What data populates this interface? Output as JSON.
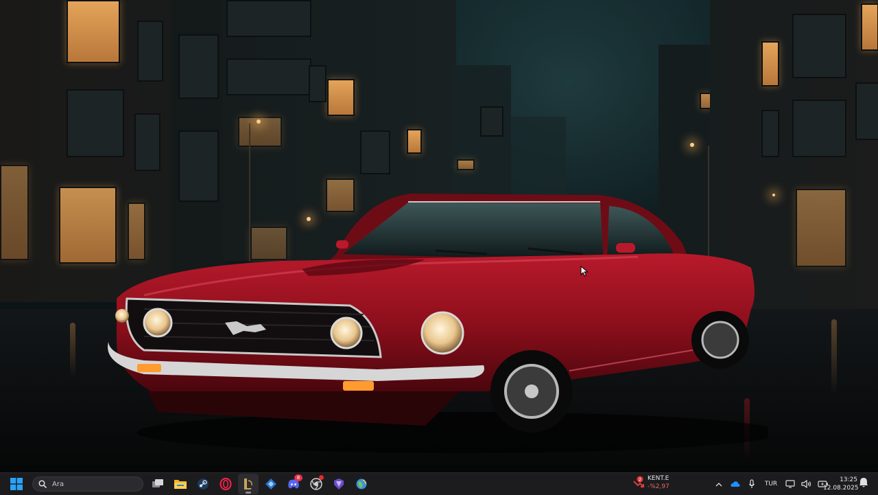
{
  "taskbar": {
    "search": {
      "placeholder": "Ara"
    },
    "apps": [
      {
        "name": "task-view-icon"
      },
      {
        "name": "file-explorer-icon"
      },
      {
        "name": "steam-icon"
      },
      {
        "name": "opera-gx-icon"
      },
      {
        "name": "league-of-legends-icon",
        "active": true
      },
      {
        "name": "valorant-tracker-icon"
      },
      {
        "name": "discord-icon",
        "badge": "8"
      },
      {
        "name": "chrome-icon"
      },
      {
        "name": "riot-client-icon"
      },
      {
        "name": "google-earth-icon"
      }
    ],
    "stock_widget": {
      "badge": "2",
      "name": "KENT.E",
      "change": "-%2,97"
    },
    "tray": {
      "language": "TUR"
    },
    "clock": {
      "time": "13:25",
      "date": "12.08.2025"
    }
  },
  "colors": {
    "taskbar_bg": "#1c1c1e",
    "car_red": "#8e0f1c",
    "windows_blue": "#2aa3ff",
    "stock_negative": "#e46a6a"
  }
}
